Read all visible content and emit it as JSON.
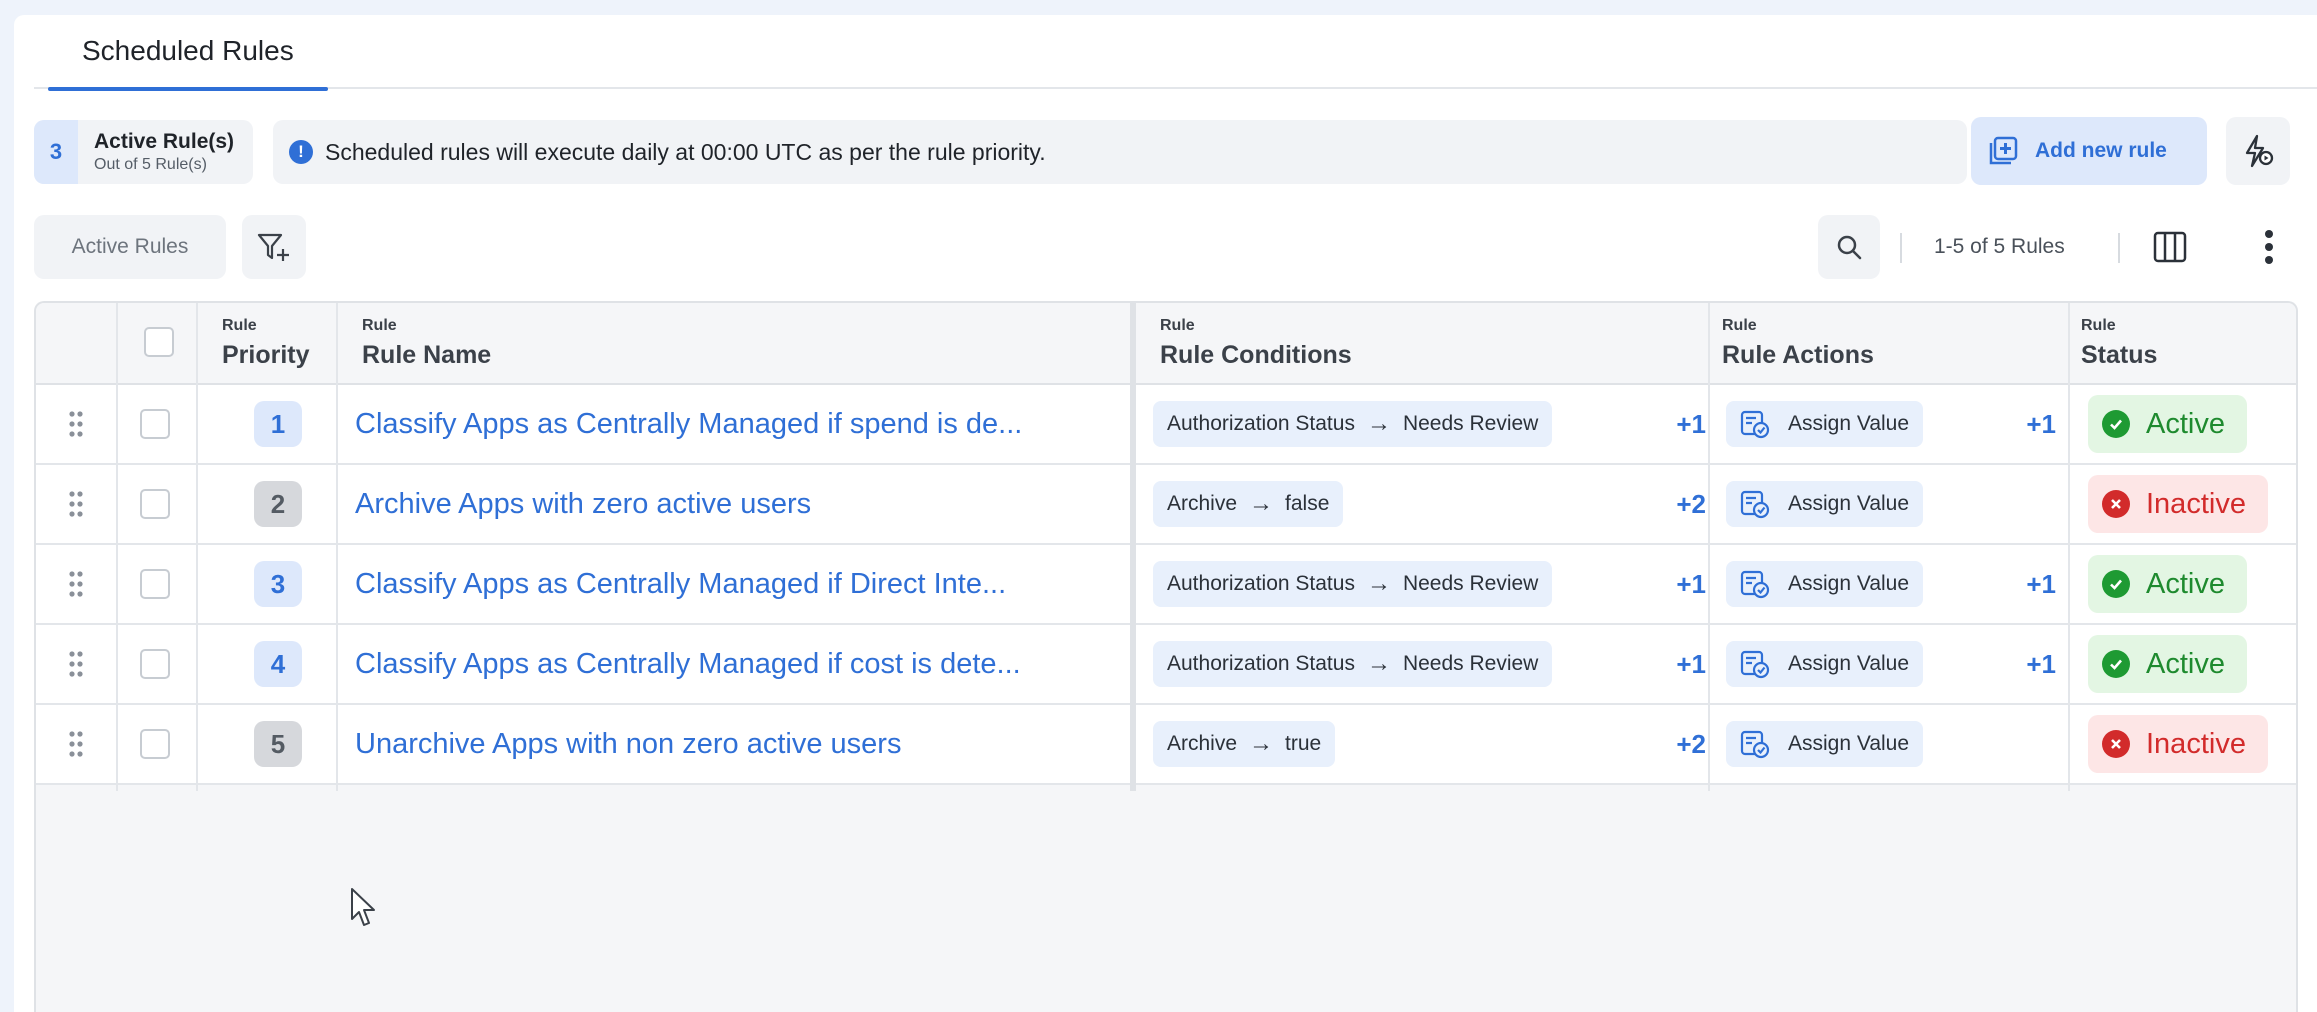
{
  "tabs": [
    {
      "label": "Scheduled Rules",
      "active": true
    }
  ],
  "summary": {
    "count": "3",
    "title": "Active Rule(s)",
    "subtitle": "Out of 5 Rule(s)"
  },
  "notice": {
    "text": "Scheduled rules will execute daily at 00:00 UTC as per the rule priority.",
    "icon": "info-icon"
  },
  "toolbar": {
    "add_rule_label": "Add new rule",
    "filter_chip_label": "Active Rules",
    "pagination": "1-5 of 5 Rules"
  },
  "table": {
    "headers": {
      "priority": {
        "small": "Rule",
        "big": "Priority"
      },
      "name": {
        "small": "Rule",
        "big": "Rule Name"
      },
      "conditions": {
        "small": "Rule",
        "big": "Rule Conditions"
      },
      "actions": {
        "small": "Rule",
        "big": "Rule Actions"
      },
      "status": {
        "small": "Rule",
        "big": "Status"
      }
    },
    "rows": [
      {
        "priority": "1",
        "name": "Classify Apps as Centrally Managed if spend is de...",
        "cond_field": "Authorization Status",
        "cond_arrow": "→",
        "cond_value": "Needs Review",
        "cond_more": "+1",
        "action": "Assign Value",
        "action_more": "+1",
        "status": "Active"
      },
      {
        "priority": "2",
        "name": "Archive Apps with zero active users",
        "cond_field": "Archive",
        "cond_arrow": "→",
        "cond_value": "false",
        "cond_more": "+2",
        "action": "Assign Value",
        "action_more": "",
        "status": "Inactive"
      },
      {
        "priority": "3",
        "name": "Classify Apps as Centrally Managed if Direct Inte...",
        "cond_field": "Authorization Status",
        "cond_arrow": "→",
        "cond_value": "Needs Review",
        "cond_more": "+1",
        "action": "Assign Value",
        "action_more": "+1",
        "status": "Active"
      },
      {
        "priority": "4",
        "name": "Classify Apps as Centrally Managed if cost is dete...",
        "cond_field": "Authorization Status",
        "cond_arrow": "→",
        "cond_value": "Needs Review",
        "cond_more": "+1",
        "action": "Assign Value",
        "action_more": "+1",
        "status": "Active"
      },
      {
        "priority": "5",
        "name": "Unarchive Apps with non zero active users",
        "cond_field": "Archive",
        "cond_arrow": "→",
        "cond_value": "true",
        "cond_more": "+2",
        "action": "Assign Value",
        "action_more": "",
        "status": "Inactive"
      }
    ]
  },
  "colors": {
    "accent": "#2f6fd6",
    "active": "#1e9a33",
    "inactive": "#d22b2b"
  }
}
